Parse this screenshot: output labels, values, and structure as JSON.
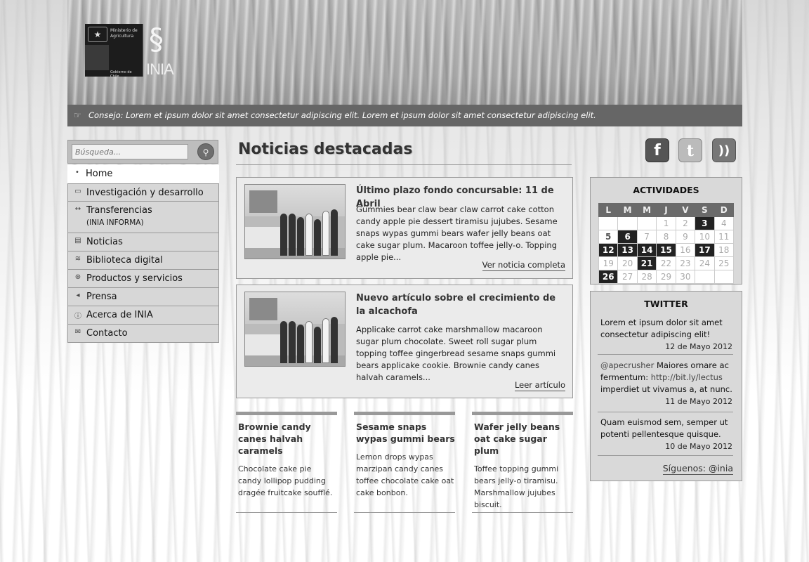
{
  "header": {
    "gov_logo_text": "Ministerio de Agricultura",
    "gov_logo_footer": "Gobierno de Chile",
    "inia_logo_text": "INIA",
    "tip": "Consejo: Lorem et ipsum dolor sit amet consectetur adipiscing elit. Lorem et ipsum dolor sit amet consectetur adipiscing elit."
  },
  "search": {
    "placeholder": "Búsqueda..."
  },
  "nav": [
    {
      "label": "Home",
      "icon": "bullet-icon"
    },
    {
      "label": "Investigación y desarrollo",
      "icon": "laptop-icon"
    },
    {
      "label": "Transferencias",
      "sub": "(INIA INFORMA)",
      "icon": "arrows-icon"
    },
    {
      "label": "Noticias",
      "icon": "document-icon"
    },
    {
      "label": "Biblioteca digital",
      "icon": "books-icon"
    },
    {
      "label": "Productos y servicios",
      "icon": "wheel-icon"
    },
    {
      "label": "Prensa",
      "icon": "megaphone-icon"
    },
    {
      "label": "Acerca de INIA",
      "icon": "info-icon"
    },
    {
      "label": "Contacto",
      "icon": "mail-icon"
    }
  ],
  "main": {
    "title": "Noticias destacadas",
    "featured": [
      {
        "title": "Último plazo fondo concursable: 11 de Abril",
        "body": "Gummies bear claw bear claw carrot cake cotton candy apple pie dessert tiramisu jujubes. Sesame snaps wypas gummi bears wafer jelly beans oat cake sugar plum. Macaroon toffee jelly-o. Topping apple pie...",
        "link": "Ver noticia completa"
      },
      {
        "title": "Nuevo artículo sobre el crecimiento de la alcachofa",
        "body": "Applicake carrot cake marshmallow macaroon sugar plum chocolate. Sweet roll sugar plum topping toffee gingerbread sesame snaps gummi bears applicake cookie. Brownie candy canes halvah caramels...",
        "link": "Leer artículo"
      }
    ],
    "columns": [
      {
        "title": "Brownie candy canes halvah caramels",
        "body": "Chocolate cake pie candy lollipop pudding dragée fruitcake soufflé."
      },
      {
        "title": "Sesame snaps wypas gummi bears",
        "body": "Lemon drops wypas marzipan candy canes toffee chocolate cake oat cake bonbon."
      },
      {
        "title": "Wafer jelly beans oat cake sugar plum",
        "body": "Toffee topping gummi bears jelly-o tiramisu. Marshmallow jujubes biscuit."
      }
    ]
  },
  "social": {
    "facebook": "f",
    "twitter": "t",
    "rss": "))"
  },
  "activities": {
    "title": "ACTIVIDADES",
    "weekdays": [
      "L",
      "M",
      "M",
      "J",
      "V",
      "S",
      "D"
    ],
    "weeks": [
      [
        "",
        "",
        "",
        "1",
        "2",
        "3",
        "4"
      ],
      [
        "5",
        "6",
        "7",
        "8",
        "9",
        "10",
        "11"
      ],
      [
        "12",
        "13",
        "14",
        "15",
        "16",
        "17",
        "18"
      ],
      [
        "19",
        "20",
        "21",
        "22",
        "23",
        "24",
        "25"
      ],
      [
        "26",
        "27",
        "28",
        "29",
        "30",
        "",
        ""
      ]
    ]
  },
  "twitter": {
    "title": "TWITTER",
    "tweets": [
      {
        "text": "Lorem et ipsum dolor sit amet consectetur adipiscing elit!",
        "date": "12 de Mayo 2012"
      },
      {
        "handle": "@apecrusher",
        "text": " Maiores ornare ac fermentum: ",
        "link": "http://bit.ly/lectus",
        "text2": " imperdiet ut vivamus a, at nunc.",
        "date": "11 de Mayo 2012"
      },
      {
        "text": "Quam euismod sem, semper ut potenti pellentesque quisque.",
        "date": "10 de Mayo 2012"
      }
    ],
    "follow": "Síguenos: @inia"
  }
}
